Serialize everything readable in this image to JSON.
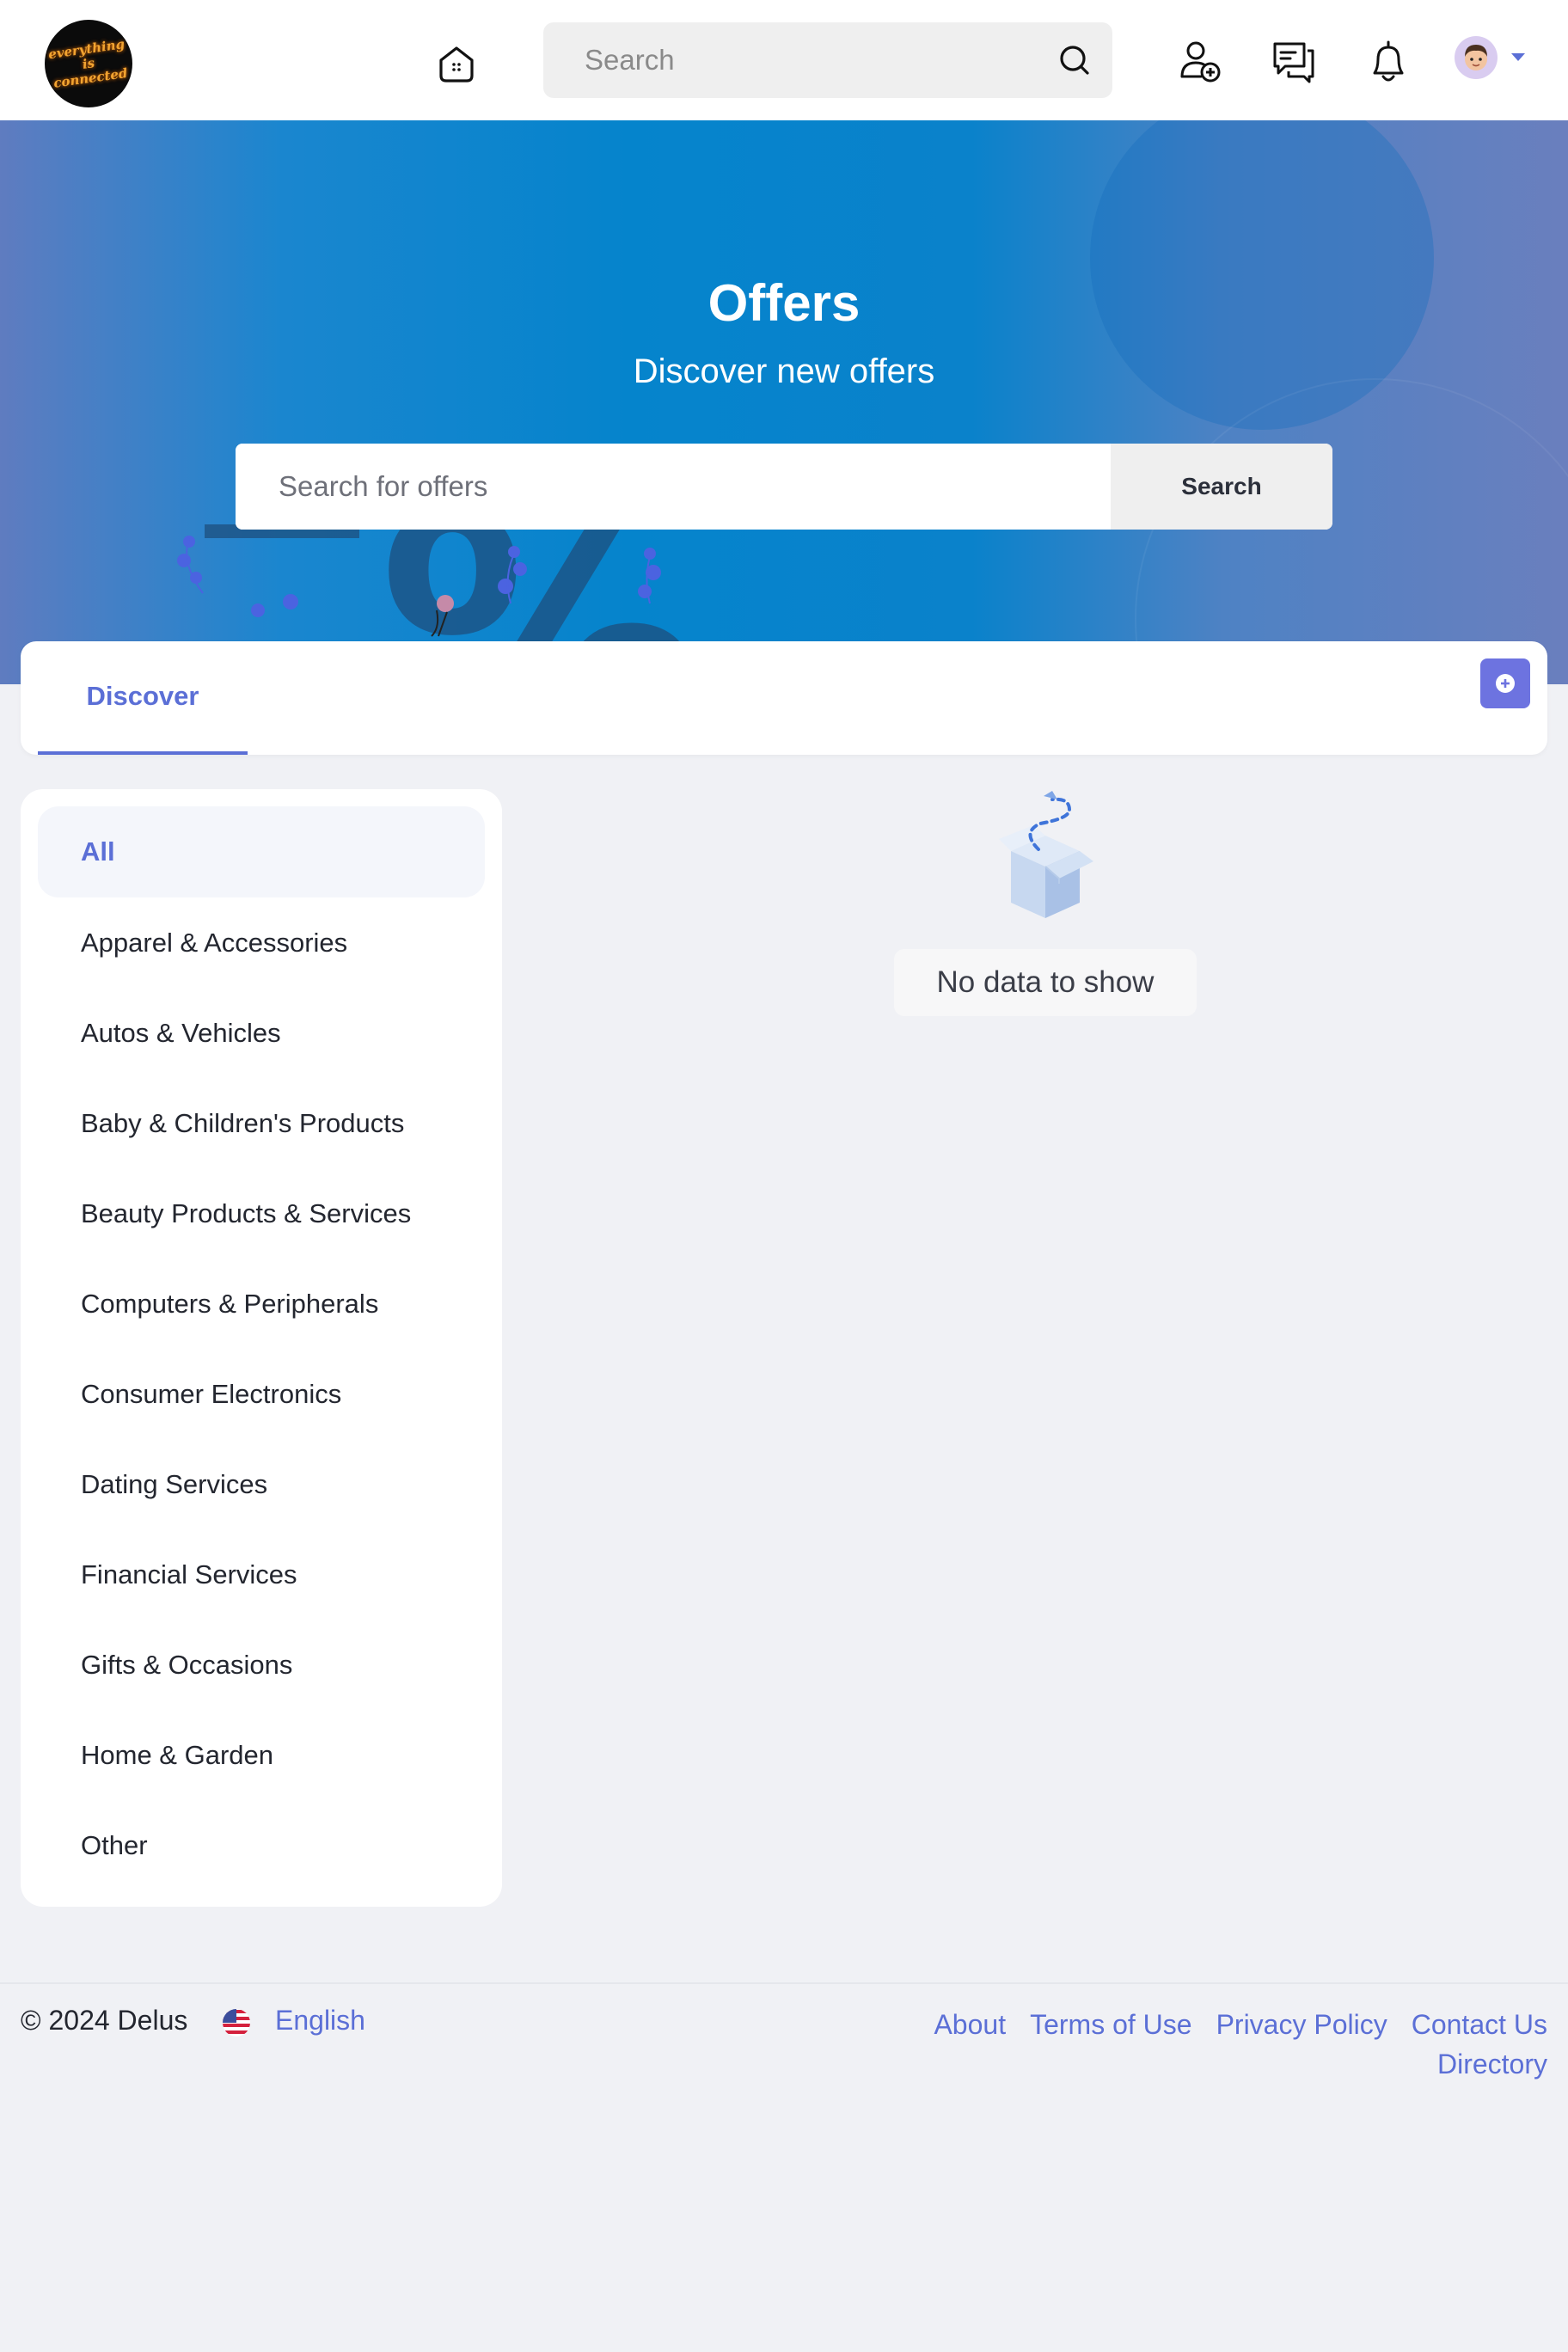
{
  "header": {
    "logo_text": "everything is connected",
    "search_placeholder": "Search"
  },
  "hero": {
    "title": "Offers",
    "subtitle": "Discover new offers",
    "search_placeholder": "Search for offers",
    "search_button": "Search"
  },
  "tabs": [
    {
      "label": "Discover",
      "active": true
    }
  ],
  "categories": [
    {
      "label": "All",
      "active": true
    },
    {
      "label": "Apparel & Accessories"
    },
    {
      "label": "Autos & Vehicles"
    },
    {
      "label": "Baby & Children's Products"
    },
    {
      "label": "Beauty Products & Services"
    },
    {
      "label": "Computers & Peripherals"
    },
    {
      "label": "Consumer Electronics"
    },
    {
      "label": "Dating Services"
    },
    {
      "label": "Financial Services"
    },
    {
      "label": "Gifts & Occasions"
    },
    {
      "label": "Home & Garden"
    },
    {
      "label": "Other"
    }
  ],
  "empty_state": {
    "message": "No data to show"
  },
  "footer": {
    "copyright": "© 2024 Delus",
    "language": "English",
    "links": [
      "About",
      "Terms of Use",
      "Privacy Policy",
      "Contact Us",
      "Directory"
    ]
  },
  "colors": {
    "accent": "#5b6fd6",
    "hero_blue": "#0584cc",
    "background": "#f0f1f5"
  },
  "icons": {
    "home": "home-icon",
    "search": "search-icon",
    "add_user": "add-user-icon",
    "messages": "messages-icon",
    "notifications": "bell-icon",
    "add": "plus-circle-icon"
  }
}
